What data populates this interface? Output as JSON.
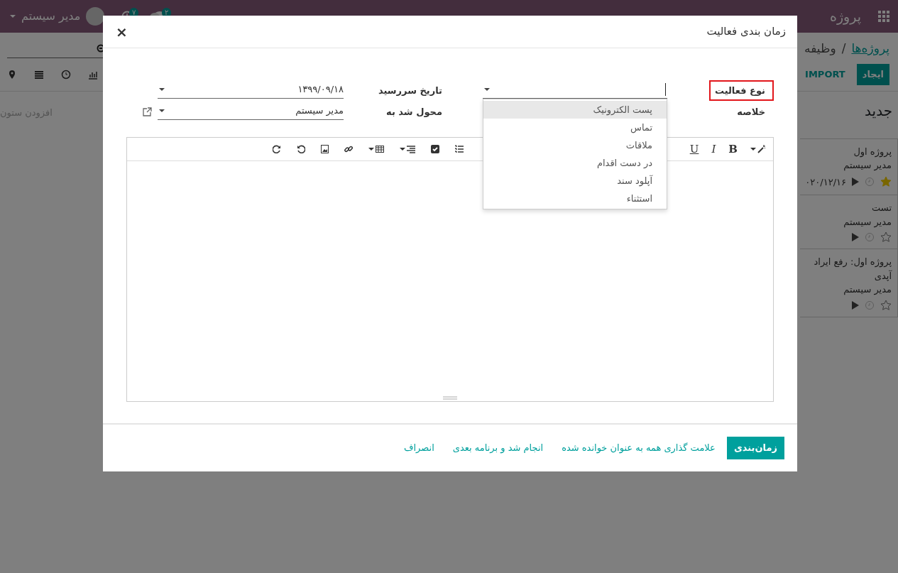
{
  "navbar": {
    "app_title": "پروژه",
    "chat_badge": "۲",
    "activity_badge": "۷",
    "user_name": "مدیر سیستم"
  },
  "control_panel": {
    "breadcrumb": [
      {
        "label": "پروژه‌ها",
        "link": true
      },
      {
        "label": "وظیفه",
        "link": false
      }
    ],
    "breadcrumb_separator": "/",
    "buttons": [
      {
        "label": "ایجاد",
        "kind": "primary"
      },
      {
        "label": "IMPORT",
        "kind": "link"
      }
    ]
  },
  "kanban": {
    "columns": [
      {
        "title": "جدید",
        "cards": [
          {
            "title": "پروژه اول",
            "assignee": "مدیر سیستم",
            "date": "۰۲۰/۱۲/۱۶",
            "starred": true
          },
          {
            "title": "تست",
            "assignee": "مدیر سیستم",
            "starred": false
          },
          {
            "title": "پروژه اول: رفع ایراد آپدی",
            "assignee": "مدیر سیستم",
            "starred": false
          }
        ]
      }
    ],
    "add_column": "افزودن ستون"
  },
  "dialog": {
    "title": "زمان بندی فعالیت",
    "close": "×",
    "activity_type": {
      "label": "نوع فعالیت",
      "highlighted": true,
      "options": [
        {
          "label": "پست الکترونیک",
          "selected": true
        },
        {
          "label": "تماس",
          "selected": false
        },
        {
          "label": "ملاقات",
          "selected": false
        },
        {
          "label": "در دست اقدام",
          "selected": false
        },
        {
          "label": "آپلود سند",
          "selected": false
        },
        {
          "label": "استثناء",
          "selected": false
        }
      ]
    },
    "summary": {
      "label": "خلاصه"
    },
    "due_date": {
      "label": "تاریخ سررسید",
      "value": "۱۳۹۹/۰۹/۱۸"
    },
    "assigned_to": {
      "label": "محول شد به",
      "value": "مدیر سیستم"
    },
    "editor": {
      "format_buttons": [
        "B",
        "I",
        "U"
      ]
    },
    "footer_buttons": [
      {
        "label": "زمان‌بندی",
        "kind": "primary"
      },
      {
        "label": "علامت گذاری همه به عنوان خوانده شده",
        "kind": "link"
      },
      {
        "label": "انجام شد و برنامه بعدی",
        "kind": "link"
      },
      {
        "label": "انصراف",
        "kind": "link"
      }
    ]
  }
}
